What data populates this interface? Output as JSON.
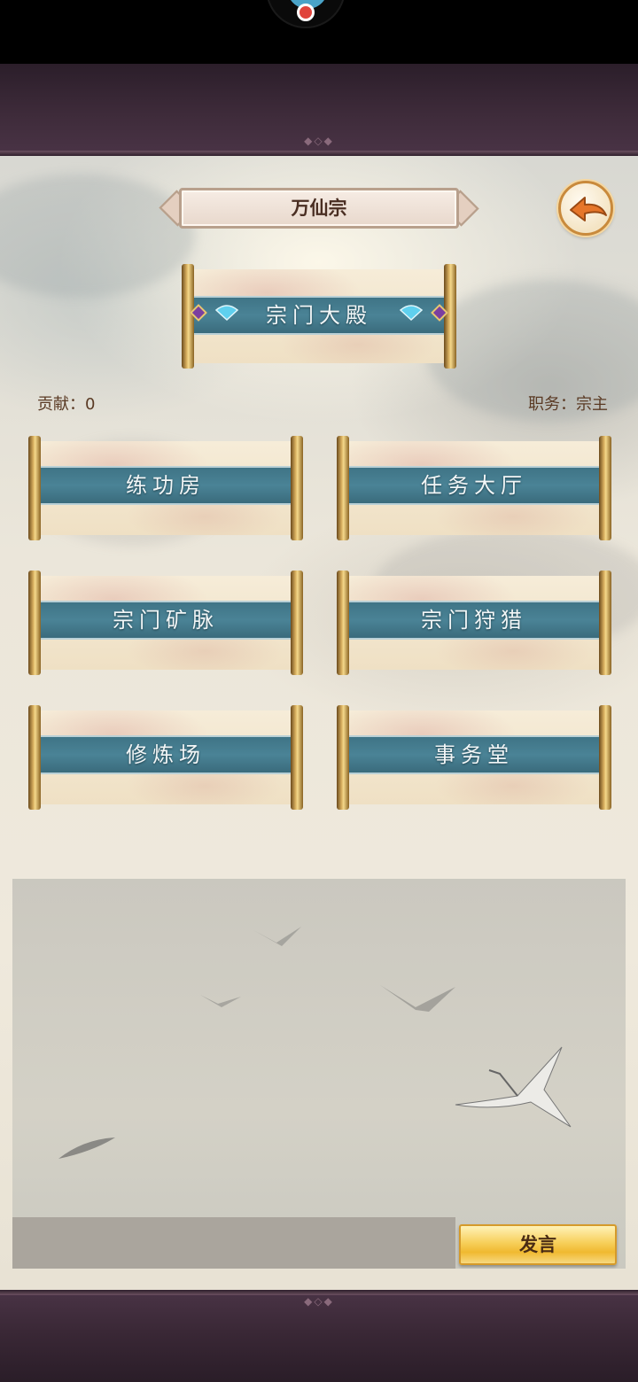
{
  "sect_name": "万仙宗",
  "hall_title": "宗门大殿",
  "contribution": "贡献：0",
  "position": "职务：宗主",
  "menu": [
    {
      "label": "练功房"
    },
    {
      "label": "任务大厅"
    },
    {
      "label": "宗门矿脉"
    },
    {
      "label": "宗门狩猎"
    },
    {
      "label": "修炼场"
    },
    {
      "label": "事务堂"
    }
  ],
  "chat": {
    "send_label": "发言",
    "input_value": ""
  },
  "icons": {
    "back": "back-arrow-icon",
    "fan": "fan-icon",
    "gem": "gem-icon"
  },
  "colors": {
    "band": "#4a8396",
    "gold": "#d9b060",
    "frame": "#3e2b3a",
    "send": "#f7cf5a"
  }
}
